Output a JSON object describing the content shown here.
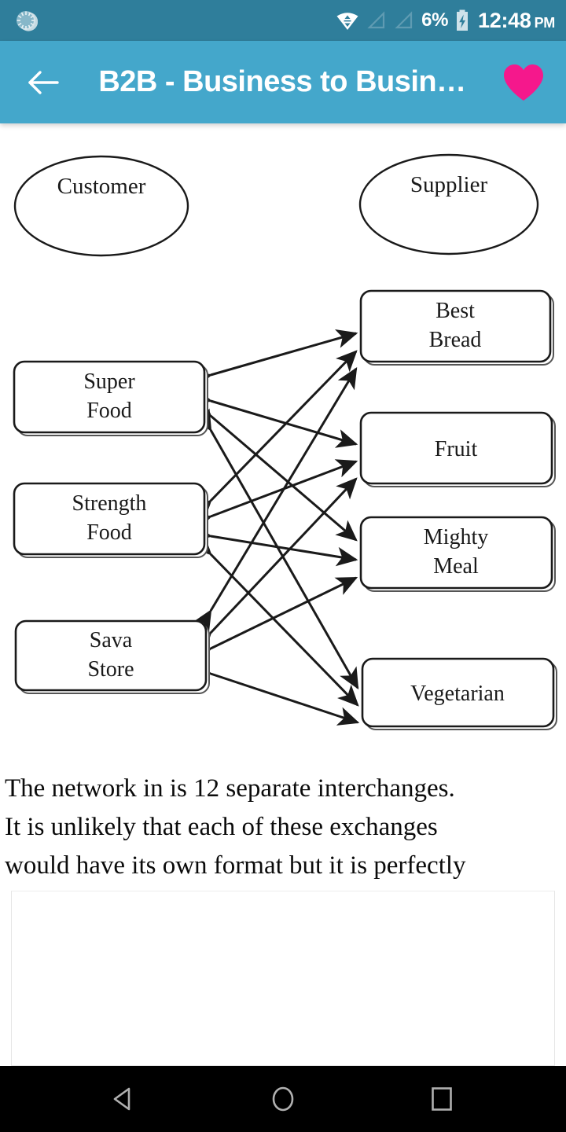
{
  "status_bar": {
    "sync_icon": "sync-spinner-icon",
    "wifi_icon": "wifi-transfer-icon",
    "signal_icons": [
      "signal-bar-icon",
      "signal-bar-icon"
    ],
    "battery_percent": "6%",
    "battery_icon": "battery-charging-icon",
    "time": "12:48",
    "meridiem": "PM"
  },
  "app_bar": {
    "back_icon": "back-arrow-icon",
    "title": "B2B - Business to Busin…",
    "favorite_icon": "heart-icon",
    "background_color": "#44a7cb",
    "favorite_color": "#f5188c"
  },
  "diagram": {
    "type": "bipartite-network",
    "actor_labels": [
      {
        "id": "customer",
        "label": "Customer",
        "shape": "ellipse"
      },
      {
        "id": "supplier",
        "label": "Supplier",
        "shape": "ellipse"
      }
    ],
    "customers": [
      {
        "id": "super-food",
        "line1": "Super",
        "line2": "Food"
      },
      {
        "id": "strength-food",
        "line1": "Strength",
        "line2": "Food"
      },
      {
        "id": "sava-store",
        "line1": "Sava",
        "line2": "Store"
      }
    ],
    "suppliers": [
      {
        "id": "best-bread",
        "line1": "Best",
        "line2": "Bread"
      },
      {
        "id": "fruit",
        "line1": "Fruit",
        "line2": ""
      },
      {
        "id": "mighty-meal",
        "line1": "Mighty",
        "line2": "Meal"
      },
      {
        "id": "vegetarian",
        "line1": "Vegetarian",
        "line2": ""
      }
    ],
    "edge_count": 12,
    "edges": [
      [
        "super-food",
        "best-bread"
      ],
      [
        "super-food",
        "fruit"
      ],
      [
        "super-food",
        "mighty-meal"
      ],
      [
        "super-food",
        "vegetarian"
      ],
      [
        "strength-food",
        "best-bread"
      ],
      [
        "strength-food",
        "fruit"
      ],
      [
        "strength-food",
        "mighty-meal"
      ],
      [
        "strength-food",
        "vegetarian"
      ],
      [
        "sava-store",
        "best-bread"
      ],
      [
        "sava-store",
        "fruit"
      ],
      [
        "sava-store",
        "mighty-meal"
      ],
      [
        "sava-store",
        "vegetarian"
      ]
    ],
    "edge_style": "double-headed-arrow"
  },
  "body_text": {
    "line1": "The network in is 12 separate interchanges.",
    "line2": "It is unlikely that each of these exchanges",
    "line3": "would have its own format but it is perfectly"
  },
  "ad_card": {
    "label": ""
  },
  "nav_bar": {
    "back_icon": "nav-back-triangle-icon",
    "home_icon": "nav-home-circle-icon",
    "recents_icon": "nav-recents-square-icon"
  }
}
